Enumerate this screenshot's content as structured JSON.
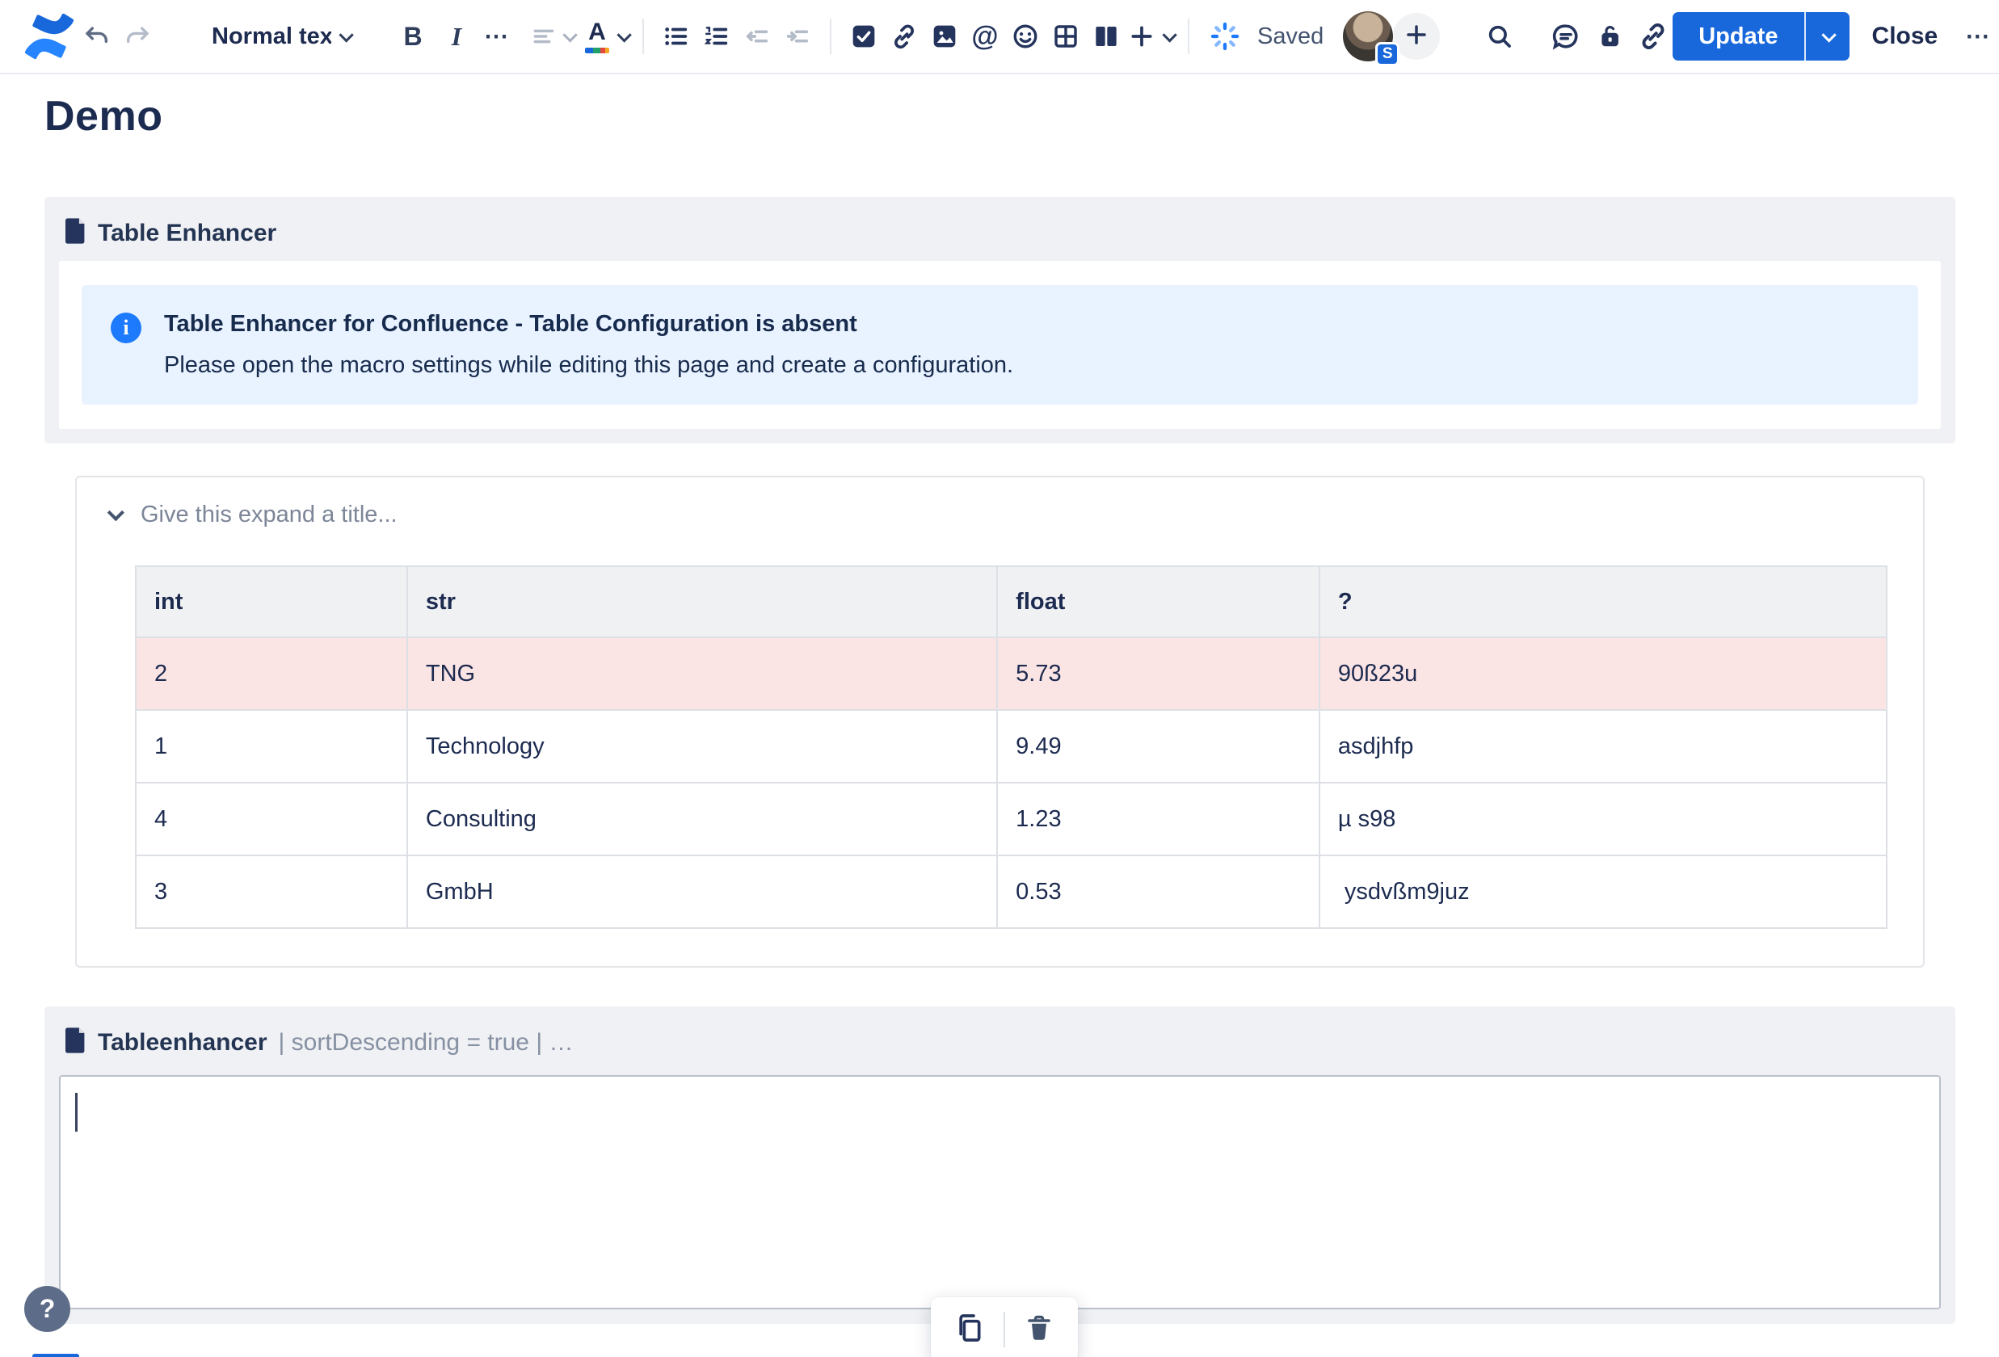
{
  "colors": {
    "accent_blue": "#1868DB",
    "info_panel_bg": "#E9F2FF",
    "highlight_row_pink": "#FBE4E4",
    "panel_gray": "#F0F1F4"
  },
  "toolbar": {
    "style_dropdown": "Normal text",
    "bold_label": "B",
    "italic_label": "I",
    "more_formatting": "⋯",
    "mention_glyph": "@",
    "save_status": "Saved",
    "avatar_badge": "S",
    "update_label": "Update",
    "close_label": "Close",
    "more_actions": "⋯"
  },
  "page": {
    "title": "Demo"
  },
  "macro_top": {
    "name": "Table Enhancer",
    "info_title": "Table Enhancer for Confluence - Table Configuration is absent",
    "info_body": "Please open the macro settings while editing this page and create a configuration."
  },
  "expand": {
    "placeholder": "Give this expand a title..."
  },
  "table": {
    "headers": [
      "int",
      "str",
      "float",
      "?"
    ],
    "rows": [
      {
        "cells": [
          "2",
          "TNG",
          "5.73",
          "90ß23u"
        ],
        "highlight": true
      },
      {
        "cells": [
          "1",
          "Technology",
          "9.49",
          "asdjhfp"
        ],
        "highlight": false
      },
      {
        "cells": [
          "4",
          "Consulting",
          "1.23",
          "µ s98"
        ],
        "highlight": false
      },
      {
        "cells": [
          "3",
          "GmbH",
          "0.53",
          " ysdvßm9juz"
        ],
        "highlight": false
      }
    ]
  },
  "macro_bottom": {
    "name": "Tableenhancer",
    "params": "| sortDescending = true | …"
  },
  "help": {
    "glyph": "?"
  }
}
